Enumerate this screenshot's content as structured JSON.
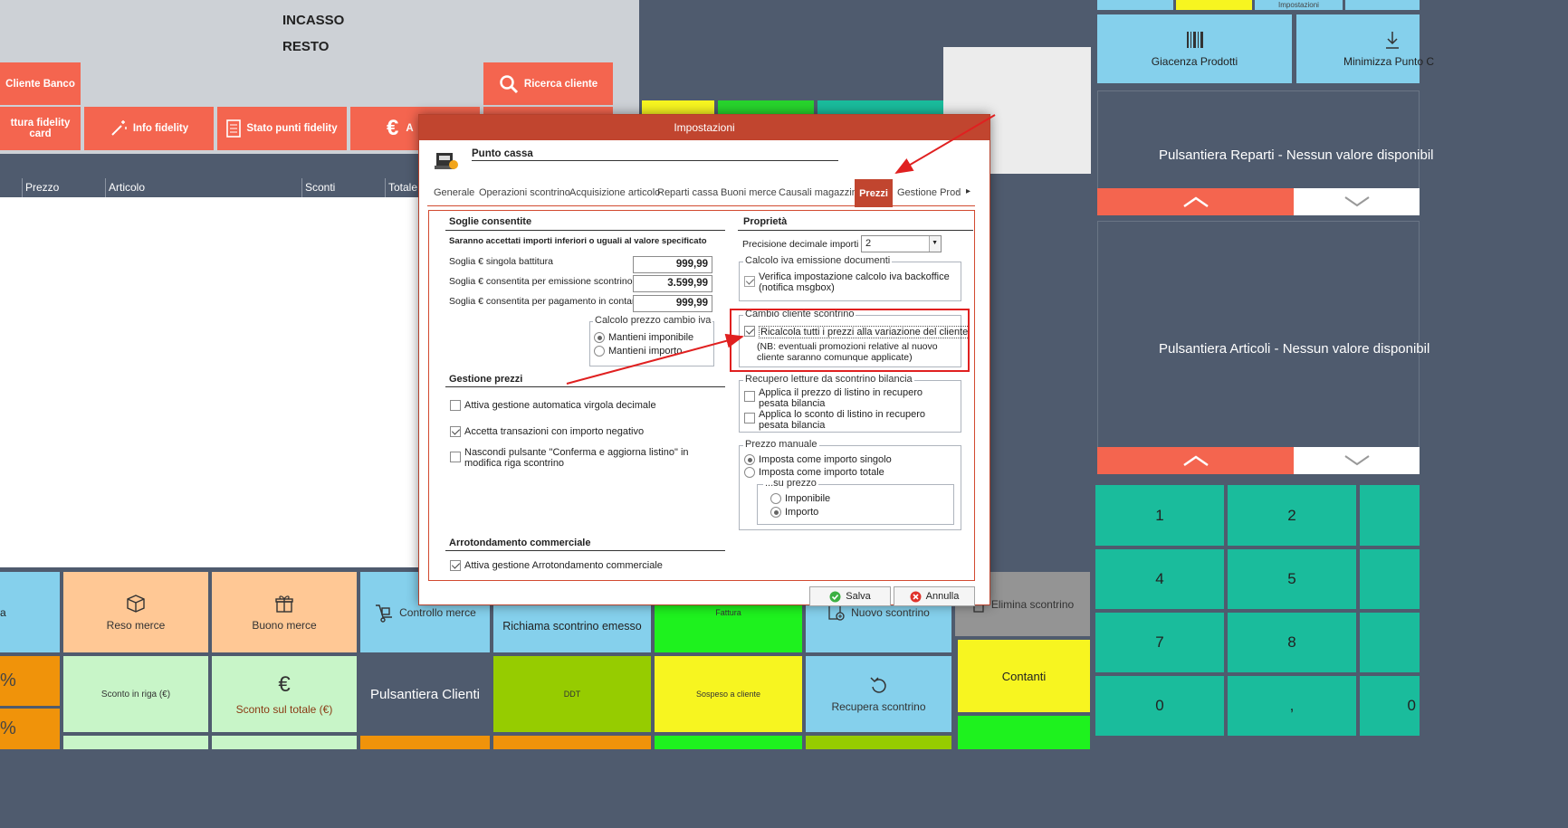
{
  "header": {
    "incasso": "INCASSO",
    "resto": "RESTO"
  },
  "customer_buttons": {
    "cliente_banco": "Cliente Banco",
    "ricerca_cliente": "Ricerca cliente",
    "lettura_fidelity": "ttura fidelity card",
    "info_fidelity": "Info fidelity",
    "stato_punti": "Stato punti fidelity",
    "partial": "A"
  },
  "table": {
    "columns": [
      "Prezzo",
      "Articolo",
      "Sconti",
      "Totale"
    ]
  },
  "top_right": {
    "impostazioni": "Impostazioni",
    "giacenza": "Giacenza Prodotti",
    "minimizza": "Minimizza Punto C"
  },
  "panels": {
    "reparti": "Pulsantiera Reparti - Nessun valore disponibil",
    "articoli": "Pulsantiera Articoli - Nessun valore disponibil"
  },
  "numpad": [
    "1",
    "2",
    "4",
    "5",
    "7",
    "8",
    "0",
    ",",
    "0"
  ],
  "bottom": {
    "a_partial": "a",
    "pct1": "%",
    "pct2": "%",
    "reso": "Reso merce",
    "buono": "Buono merce",
    "controllo": "Controllo merce",
    "richiama": "Richiama scontrino emesso",
    "fattura": "Fattura",
    "nuovo": "Nuovo scontrino",
    "elimina": "Elimina scontrino",
    "sconto_riga": "Sconto in riga (€)",
    "sconto_totale": "Sconto sul totale (€)",
    "pulsantiera_clienti": "Pulsantiera Clienti",
    "ddt": "DDT",
    "sospeso": "Sospeso a cliente",
    "recupera": "Recupera scontrino",
    "contanti": "Contanti"
  },
  "dialog": {
    "title": "Impostazioni",
    "section": "Punto cassa",
    "tabs": [
      "Generale",
      "Operazioni scontrino",
      "Acquisizione articolo",
      "Reparti cassa",
      "Buoni merce",
      "Causali magazzino",
      "Prezzi",
      "Gestione Prod"
    ],
    "soglie": {
      "title": "Soglie consentite",
      "note": "Saranno accettati importi inferiori o uguali al valore specificato",
      "rows": [
        {
          "label": "Soglia € singola battitura",
          "value": "999,99"
        },
        {
          "label": "Soglia € consentita per emissione scontrino",
          "value": "3.599,99"
        },
        {
          "label": "Soglia € consentita per pagamento in contanti",
          "value": "999,99"
        }
      ],
      "calcolo": {
        "title": "Calcolo prezzo cambio iva",
        "opt1": "Mantieni imponibile",
        "opt2": "Mantieni importo"
      }
    },
    "gestione": {
      "title": "Gestione prezzi",
      "opt1": "Attiva gestione automatica virgola decimale",
      "opt2": "Accetta transazioni con importo negativo",
      "opt3": "Nascondi pulsante \"Conferma e aggiorna listino\" in modifica riga scontrino"
    },
    "arrot": {
      "title": "Arrotondamento commerciale",
      "opt1": "Attiva gestione Arrotondamento commerciale"
    },
    "proprieta": {
      "title": "Proprietà",
      "precisione_label": "Precisione decimale importi",
      "precisione_value": "2",
      "calcolo_iva": {
        "title": "Calcolo iva emissione documenti",
        "opt1": "Verifica impostazione calcolo iva backoffice (notifica msgbox)"
      },
      "cambio": {
        "title": "Cambio cliente scontrino",
        "opt1": "Ricalcola tutti i prezzi alla variazione del cliente",
        "note": "(NB: eventuali promozioni relative al nuovo cliente saranno comunque applicate)"
      },
      "recupero": {
        "title": "Recupero letture da scontrino bilancia",
        "opt1": "Applica il prezzo di listino in recupero pesata bilancia",
        "opt2": "Applica lo sconto di listino in recupero pesata bilancia"
      },
      "manuale": {
        "title": "Prezzo manuale",
        "opt1": "Imposta come importo singolo",
        "opt2": "Imposta come importo totale",
        "su": "...su prezzo",
        "su1": "Imponibile",
        "su2": "Importo"
      }
    },
    "salva": "Salva",
    "annulla": "Annulla"
  },
  "colors": {
    "red": "#f4654f",
    "teal": "#1abc9c",
    "slate": "#4f5b6e",
    "title_bar": "#c1452f",
    "highlight": "#e02020"
  }
}
